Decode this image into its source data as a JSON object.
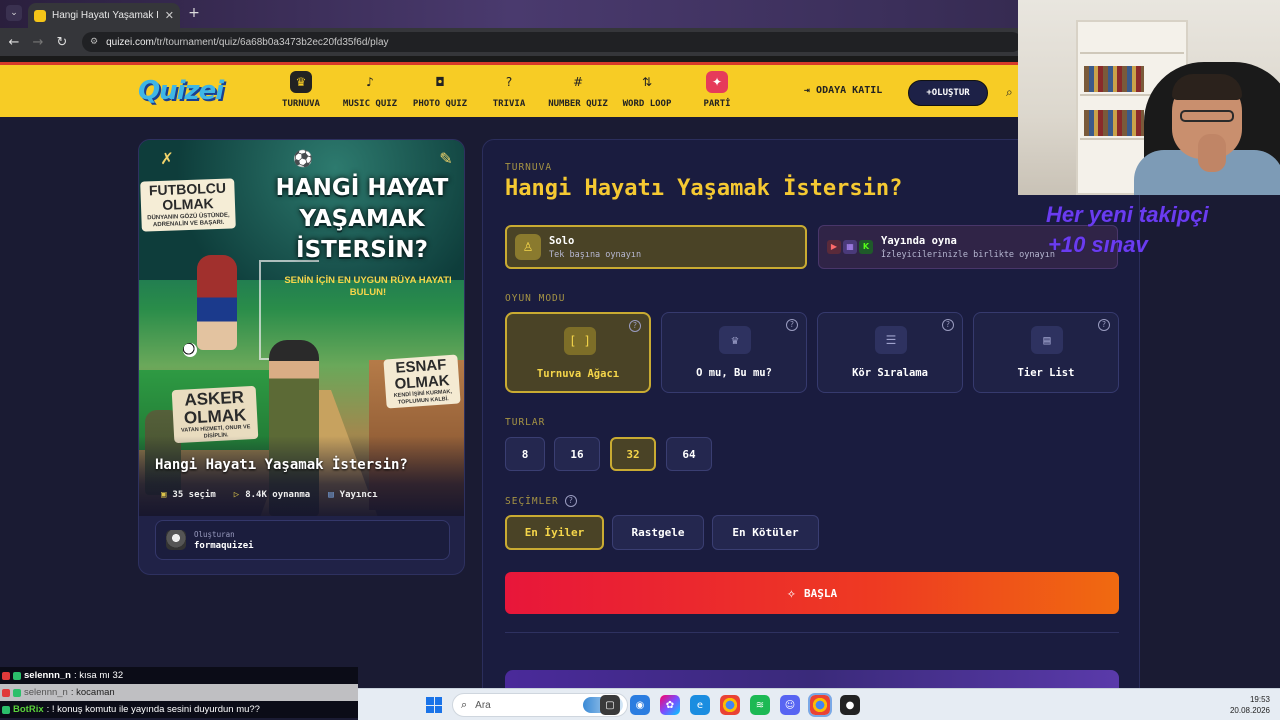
{
  "browser": {
    "tab_title": "Hangi Hayatı Yaşamak İstersin?",
    "url_domain": "quizei.com",
    "url_path": "/tr/tournament/quiz/6a68b0a3473b2ec20fd35f6d/play"
  },
  "header": {
    "logo": "Quizei",
    "nav": [
      {
        "label": "TURNUVA",
        "icon": "trophy-icon"
      },
      {
        "label": "MUSIC QUIZ",
        "icon": "music-note-icon"
      },
      {
        "label": "PHOTO QUIZ",
        "icon": "camera-icon"
      },
      {
        "label": "TRIVIA",
        "icon": "question-bubble-icon"
      },
      {
        "label": "NUMBER QUIZ",
        "icon": "hash-icon"
      },
      {
        "label": "WORD LOOP",
        "icon": "sort-icon"
      },
      {
        "label": "PARTİ",
        "icon": "party-popper-icon"
      }
    ],
    "join_label": "ODAYA KATIL",
    "create_label": "OLUŞTUR"
  },
  "cover": {
    "art": {
      "title": "HANGİ HAYAT YAŞAMAK İSTERSİN?",
      "subtitle": "SENİN İÇİN EN UYGUN RÜYA HAYATI BULUN!",
      "futbolcu_title": "FUTBOLCU OLMAK",
      "futbolcu_sub": "DÜNYANIN GÖZÜ ÜSTÜNDE, ADRENALİN VE BAŞARI.",
      "esnaf_title": "ESNAF OLMAK",
      "esnaf_sub": "KENDİ İŞİNİ KURMAK, TOPLUMUN KALBİ.",
      "asker_title": "ASKER OLMAK",
      "asker_sub": "VATAN HİZMETİ, ONUR VE DİSİPLİN."
    },
    "name": "Hangi Hayatı Yaşamak İstersin?",
    "stats": [
      {
        "icon": "images-icon",
        "text": "35 seçim"
      },
      {
        "icon": "play-icon",
        "text": "8.4K oynanma"
      },
      {
        "icon": "broadcast-icon",
        "text": "Yayıncı"
      }
    ],
    "creator_label": "Oluşturan",
    "creator_name": "formaquizei"
  },
  "panel": {
    "eyebrow": "TURNUVA",
    "title": "Hangi Hayatı Yaşamak İstersin?",
    "solo": {
      "title": "Solo",
      "subtitle": "Tek başına oynayın",
      "selected": true
    },
    "stream": {
      "title": "Yayında oyna",
      "subtitle": "İzleyicilerinizle birlikte oynayın",
      "selected": false
    },
    "game_mode_label": "OYUN MODU",
    "game_modes": [
      {
        "label": "Turnuva Ağacı",
        "glyph": "[ ]",
        "selected": true
      },
      {
        "label": "O mu, Bu mu?",
        "glyph": "♛",
        "selected": false
      },
      {
        "label": "Kör Sıralama",
        "glyph": "☰",
        "selected": false
      },
      {
        "label": "Tier List",
        "glyph": "▤",
        "selected": false
      }
    ],
    "rounds_label": "TURLAR",
    "rounds": [
      "8",
      "16",
      "32",
      "64"
    ],
    "rounds_selected": "32",
    "picks_label": "SEÇİMLER",
    "picks": [
      "En İyiler",
      "Rastgele",
      "En Kötüler"
    ],
    "picks_selected": "En İyiler",
    "start_label": "BAŞLA"
  },
  "stream_overlay": {
    "text_line1": "Her yeni takipçi",
    "text_line2": "+10 sınav"
  },
  "chat": [
    {
      "user": "selennn_n",
      "message": ": kısa mı 32"
    },
    {
      "user": "selennn_n",
      "message": ": kocaman"
    },
    {
      "user": "BotRix",
      "message": ": ! konuş komutu ile yayında sesini duyurdun mu??"
    }
  ],
  "taskbar": {
    "search_placeholder": "Ara",
    "time": "19:53",
    "date": "20.08.2026"
  },
  "colors": {
    "accent_yellow": "#f5c932",
    "header_yellow": "#f7cc25",
    "start_red": "#e8163a",
    "start_orange": "#f06a10",
    "panel_bg": "#1a1c3f",
    "overlay_purple": "#6a3cf0"
  }
}
